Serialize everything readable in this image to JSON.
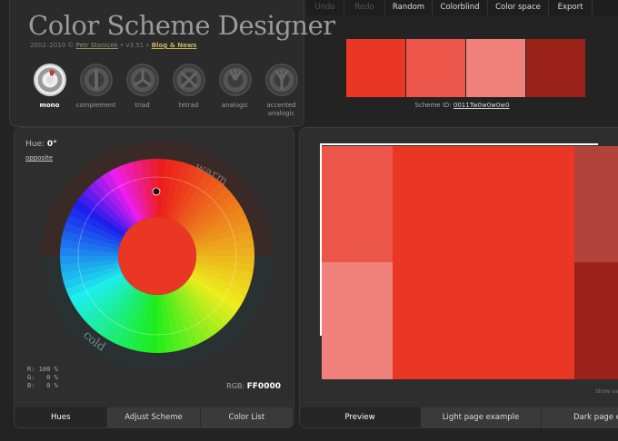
{
  "app": {
    "title": "Color Scheme Designer",
    "credits_prefix": "2002–2010 ©",
    "author": "Petr Stanicek",
    "version": "• v3.51 •",
    "blog": "Blog & News"
  },
  "schemes": [
    {
      "label": "mono",
      "icon": "mono-scheme-icon",
      "active": true
    },
    {
      "label": "complement",
      "icon": "complement-scheme-icon",
      "active": false
    },
    {
      "label": "triad",
      "icon": "triad-scheme-icon",
      "active": false
    },
    {
      "label": "tetrad",
      "icon": "tetrad-scheme-icon",
      "active": false
    },
    {
      "label": "analogic",
      "icon": "analogic-scheme-icon",
      "active": false
    },
    {
      "label": "accented analogic",
      "icon": "accented-analogic-scheme-icon",
      "active": false
    }
  ],
  "menu": {
    "undo": "Undo",
    "redo": "Redo",
    "random": "Random",
    "colorblind": "Colorblind",
    "colorspace": "Color space",
    "export": "Export"
  },
  "swatches": [
    "#ea3723",
    "#ec554a",
    "#f0827b",
    "#9a2219"
  ],
  "scheme_id": {
    "label": "Scheme ID:",
    "value": "0011Tw0w0w0w0"
  },
  "wheel": {
    "hue_label": "Hue:",
    "hue_value": "0°",
    "opposite": "opposite",
    "warm": "warm",
    "cold": "cold",
    "center_color": "#ea3723",
    "rgb_r": "R: 100 %",
    "rgb_g": "G:   0 %",
    "rgb_b": "B:   0 %",
    "rgb_label": "RGB:",
    "rgb_hex": "FF0000"
  },
  "left_tabs": [
    "Hues",
    "Adjust Scheme",
    "Color List"
  ],
  "right_tabs": [
    "Preview",
    "Light page example",
    "Dark page exa"
  ],
  "preview": {
    "show_samples": "Show sa"
  }
}
